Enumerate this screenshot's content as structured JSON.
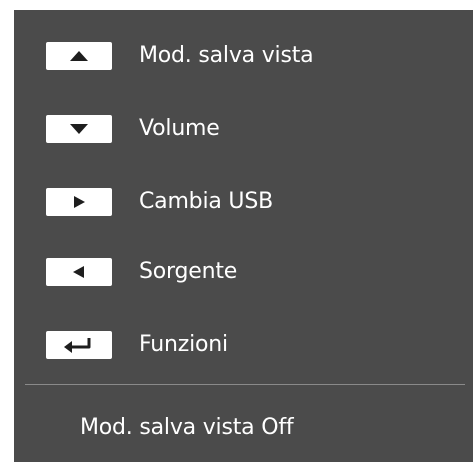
{
  "menu": {
    "items": [
      {
        "icon": "triangle-up-icon",
        "label": "Mod. salva vista"
      },
      {
        "icon": "triangle-down-icon",
        "label": "Volume"
      },
      {
        "icon": "triangle-right-icon",
        "label": "Cambia USB"
      },
      {
        "icon": "triangle-left-icon",
        "label": "Sorgente"
      },
      {
        "icon": "enter-return-icon",
        "label": "Funzioni"
      }
    ]
  },
  "status": {
    "text": "Mod. salva vista Off"
  },
  "colors": {
    "panel_background": "#4b4b4b",
    "key_background": "#ffffff",
    "glyph": "#1e1e1e",
    "text": "#ffffff",
    "divider": "#8a8a8a"
  }
}
